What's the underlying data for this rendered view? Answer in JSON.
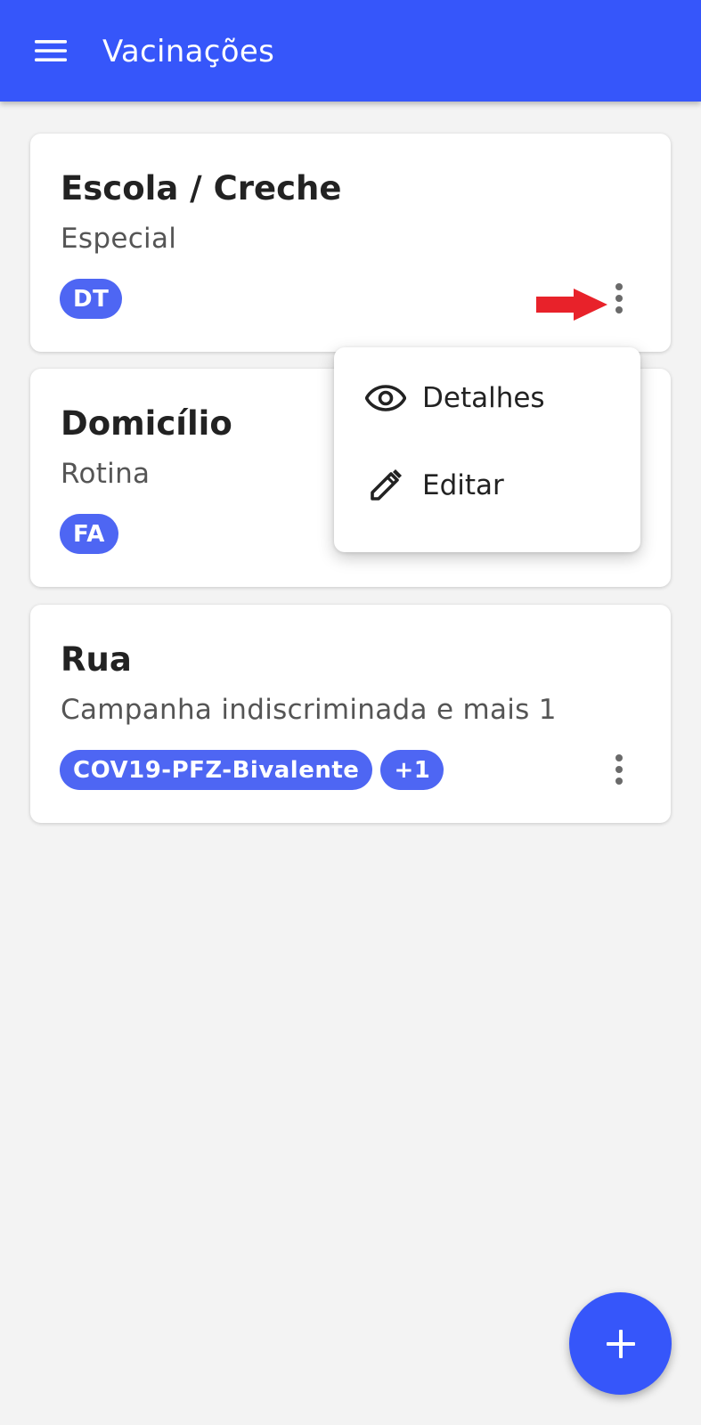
{
  "app": {
    "title": "Vacinações",
    "accent_color": "#3656fa",
    "chip_color": "#4e66f3",
    "menu_icon": "hamburger-menu-icon"
  },
  "cards": [
    {
      "title": "Escola / Creche",
      "subtitle": "Especial",
      "chips": [
        "DT"
      ],
      "more_icon": "more-vertical-icon"
    },
    {
      "title": "Domicílio",
      "subtitle": "Rotina",
      "chips": [
        "FA"
      ],
      "more_icon": "more-vertical-icon"
    },
    {
      "title": "Rua",
      "subtitle": "Campanha indiscriminada e mais 1",
      "chips": [
        "COV19-PFZ-Bivalente",
        "+1"
      ],
      "more_icon": "more-vertical-icon"
    }
  ],
  "context_menu": {
    "items": [
      {
        "label": "Detalhes",
        "icon": "eye-icon"
      },
      {
        "label": "Editar",
        "icon": "pencil-icon"
      }
    ]
  },
  "annotation": {
    "icon": "red-arrow-icon",
    "color": "#e8222a"
  },
  "fab": {
    "icon": "plus-icon"
  }
}
